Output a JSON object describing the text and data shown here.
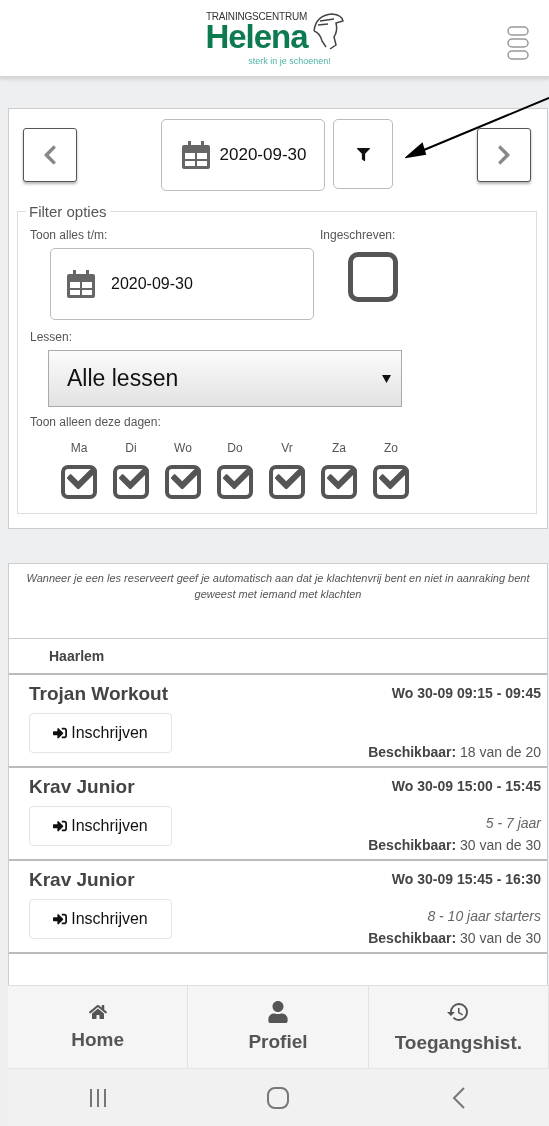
{
  "header": {
    "logo_top": "TRAININGSCENTRUM",
    "logo_name": "Helena",
    "tagline": "sterk in je schoenen!"
  },
  "date_nav": {
    "date": "2020-09-30"
  },
  "filter": {
    "legend": "Filter opties",
    "until_label": "Toon alles t/m:",
    "until_date": "2020-09-30",
    "enrolled_label": "Ingeschreven:",
    "enrolled_checked": false,
    "lessons_label": "Lessen:",
    "lessons_value": "Alle lessen",
    "days_label": "Toon alleen deze dagen:",
    "days": [
      {
        "label": "Ma",
        "checked": true
      },
      {
        "label": "Di",
        "checked": true
      },
      {
        "label": "Wo",
        "checked": true
      },
      {
        "label": "Do",
        "checked": true
      },
      {
        "label": "Vr",
        "checked": true
      },
      {
        "label": "Za",
        "checked": true
      },
      {
        "label": "Zo",
        "checked": true
      }
    ]
  },
  "notice": "Wanneer je een les reserveert geef je automatisch aan dat je klachtenvrij bent en niet in aanraking bent geweest met iemand met klachten",
  "location": "Haarlem",
  "lessons": [
    {
      "title": "Trojan Workout",
      "time": "Wo 30-09 09:15 - 09:45",
      "availability_label": "Beschikbaar:",
      "availability_value": "18 van de 20",
      "button": "Inschrijven"
    },
    {
      "title": "Krav Junior",
      "time": "Wo 30-09 15:00 - 15:45",
      "note": "5 - 7 jaar",
      "availability_label": "Beschikbaar:",
      "availability_value": "30 van de 30",
      "button": "Inschrijven"
    },
    {
      "title": "Krav Junior",
      "time": "Wo 30-09 15:45 - 16:30",
      "note": "8 - 10 jaar starters",
      "availability_label": "Beschikbaar:",
      "availability_value": "30 van de 30",
      "button": "Inschrijven"
    }
  ],
  "bottom_nav": [
    {
      "label": "Home",
      "kind": "home"
    },
    {
      "label": "Profiel",
      "kind": "profile"
    },
    {
      "label": "Toegangshist.",
      "kind": "history"
    }
  ]
}
